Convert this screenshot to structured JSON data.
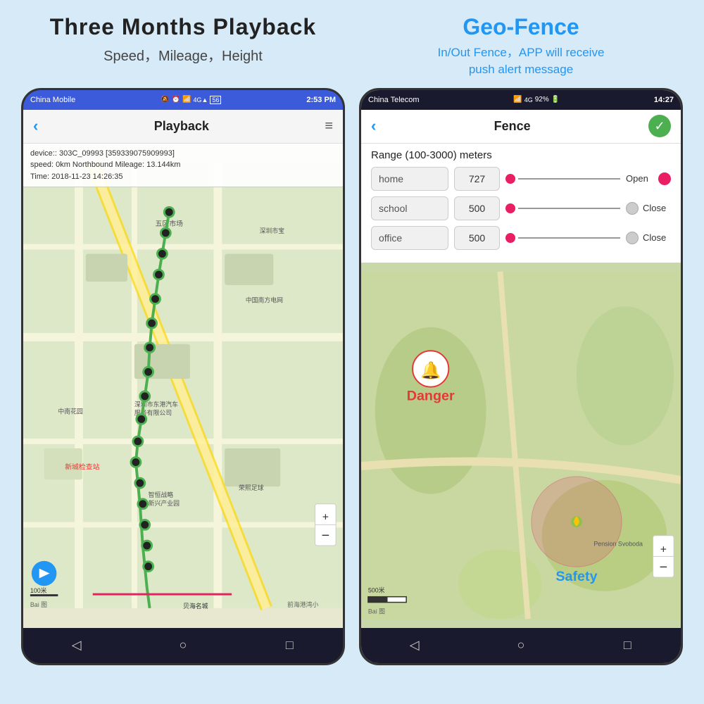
{
  "page": {
    "background": "#d6eaf8"
  },
  "left_section": {
    "title": "Three Months Playback",
    "subtitle": "Speed，Mileage，Height"
  },
  "right_section": {
    "title": "Geo-Fence",
    "subtitle": "In/Out Fence，APP will receive\npush alert message"
  },
  "playback_phone": {
    "status_bar": {
      "carrier": "China Mobile",
      "time": "2:53 PM",
      "icons": "⚡ ⏰ ☁ ▲ 56"
    },
    "header": {
      "title": "Playback",
      "back": "‹",
      "menu_icon": "≡"
    },
    "info_box": {
      "line1": "device:: 303C_09993 [359339075909993]",
      "line2": "speed: 0km Northbound Mileage: 13.144km",
      "line3": "Time: 2018-11-23 14:26:35"
    },
    "zoom_plus": "+",
    "zoom_minus": "−",
    "scale_label": "100米",
    "baidu_label": "Bai 图",
    "bottom_nav": [
      "◁",
      "○",
      "□"
    ]
  },
  "fence_phone": {
    "status_bar": {
      "carrier": "China Telecom",
      "time": "14:27",
      "battery": "92%"
    },
    "header": {
      "back": "‹",
      "title": "Fence",
      "check": "✓"
    },
    "range_label": "Range (100-3000) meters",
    "fence_rows": [
      {
        "name": "home",
        "value": "727",
        "toggle_state": "Open",
        "toggle_on": true
      },
      {
        "name": "school",
        "value": "500",
        "toggle_state": "Close",
        "toggle_on": false
      },
      {
        "name": "office",
        "value": "500",
        "toggle_state": "Close",
        "toggle_on": false
      }
    ],
    "map": {
      "danger_text": "Danger",
      "safety_text": "Safety",
      "scale_label": "500米",
      "pension_label": "Pension Svoboda"
    },
    "zoom_plus": "+",
    "zoom_minus": "−",
    "bottom_nav": [
      "◁",
      "○",
      "□"
    ]
  }
}
